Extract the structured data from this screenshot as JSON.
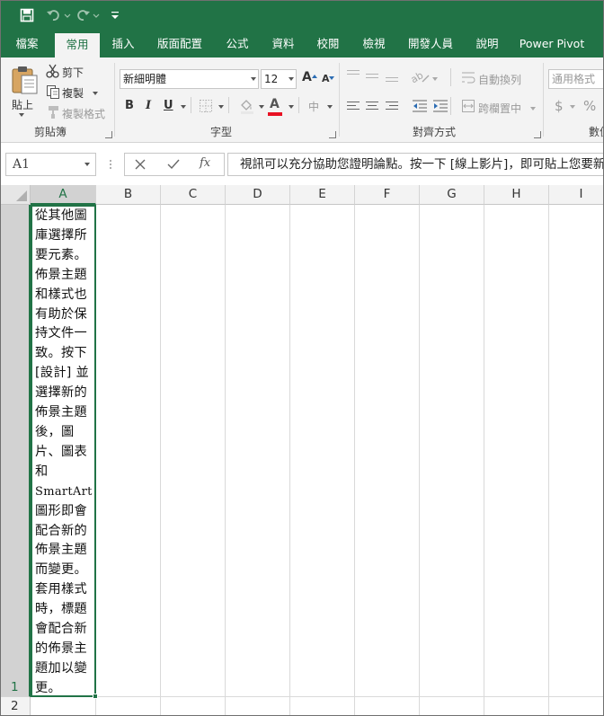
{
  "title_bar": {
    "save_icon": "save-icon",
    "undo_icon": "undo-icon",
    "redo_icon": "redo-icon",
    "customize_icon": "customize-quick-access-icon"
  },
  "tabs": [
    "檔案",
    "常用",
    "插入",
    "版面配置",
    "公式",
    "資料",
    "校閱",
    "檢視",
    "開發人員",
    "說明",
    "Power Pivot"
  ],
  "active_tab": "常用",
  "clipboard": {
    "paste": "貼上",
    "cut": "剪下",
    "copy": "複製",
    "format_painter": "複製格式",
    "label": "剪貼簿"
  },
  "font": {
    "name": "新細明體",
    "size": "12",
    "grow": "A",
    "shrink": "A",
    "bold": "B",
    "italic": "I",
    "underline": "U",
    "font_color_glyph": "A",
    "phonetic_glyph": "中",
    "label": "字型"
  },
  "alignment": {
    "wrap_text": "自動換列",
    "merge_center": "跨欄置中",
    "label": "對齊方式"
  },
  "number": {
    "format": "通用格式",
    "currency": "$",
    "percent": "%",
    "label": "數值"
  },
  "formula_bar": {
    "name_box": "A1",
    "fx": "fx",
    "formula": "視訊可以充分協助您證明論點。按一下 [線上影片]，即可貼上您要新增之影片的內嵌程式碼。您也可以輸入關鍵字，線上搜尋最適合您文件的影片。"
  },
  "sheet": {
    "columns": [
      "A",
      "B",
      "C",
      "D",
      "E",
      "F",
      "G",
      "H",
      "I"
    ],
    "rows": [
      "1",
      "2"
    ],
    "selected_cell": "A1",
    "a1_lines": [
      "從其他圖",
      "庫選擇所",
      "要元素。",
      "佈景主題",
      "和樣式也",
      "有助於保",
      "持文件一",
      "致。按下",
      "[設計] 並",
      "選擇新的",
      "佈景主題",
      "後，圖",
      "片、圖表",
      "和",
      "SmartArt",
      "圖形即會",
      "配合新的",
      "佈景主題",
      "而變更。",
      "套用樣式",
      "時，標題",
      "會配合新",
      "的佈景主",
      "題加以變",
      "更。"
    ]
  },
  "colors": {
    "accent": "#217346",
    "font_color_bar": "#e81123",
    "grid": "#d9d9d9"
  }
}
